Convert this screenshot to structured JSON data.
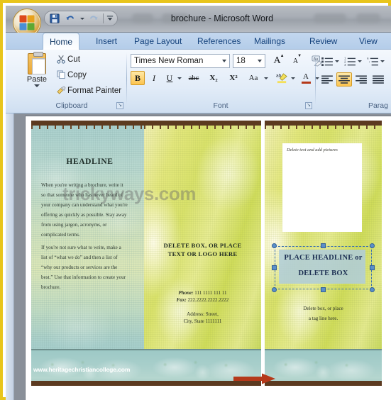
{
  "window": {
    "title": "brochure - Microsoft Word",
    "office_button": "office-orb"
  },
  "quick_access": {
    "items": [
      {
        "name": "save",
        "icon": "save-icon",
        "label": "Save"
      },
      {
        "name": "undo",
        "icon": "undo-icon",
        "label": "Undo"
      },
      {
        "name": "redo",
        "icon": "redo-icon",
        "label": "Redo"
      },
      {
        "name": "customize",
        "icon": "customize-qat-icon",
        "label": "Customize Quick Access Toolbar"
      }
    ]
  },
  "ribbon": {
    "tabs": [
      {
        "label": "Home",
        "active": true
      },
      {
        "label": "Insert",
        "active": false
      },
      {
        "label": "Page Layout",
        "active": false
      },
      {
        "label": "References",
        "active": false
      },
      {
        "label": "Mailings",
        "active": false
      },
      {
        "label": "Review",
        "active": false
      },
      {
        "label": "View",
        "active": false
      }
    ],
    "clipboard": {
      "group_label": "Clipboard",
      "paste_label": "Paste",
      "cut_label": "Cut",
      "copy_label": "Copy",
      "format_painter_label": "Format Painter",
      "cut_icon": "scissors-icon",
      "copy_icon": "copy-icon",
      "format_painter_icon": "paintbrush-icon",
      "paste_icon": "clipboard-icon",
      "launcher_label": "↘"
    },
    "font": {
      "group_label": "Font",
      "font_name": "Times New Roman",
      "font_size": "18",
      "grow_font": "A",
      "shrink_font": "A",
      "clear_formatting": "Aa",
      "bold": "B",
      "italic": "I",
      "underline": "U",
      "strikethrough": "abc",
      "subscript": "X₂",
      "superscript": "X²",
      "change_case": "Aa",
      "highlight": "ab",
      "font_color": "A",
      "bold_active": true,
      "launcher_label": "↘"
    },
    "paragraph": {
      "group_label": "Parag",
      "bullets": "bullets-icon",
      "numbering": "numbering-icon",
      "multilevel": "multilevel-list-icon",
      "align_left": "align-left-icon",
      "align_center": "align-center-icon",
      "align_right": "align-right-icon",
      "justify": "justify-icon",
      "active_alignment": "center"
    }
  },
  "document": {
    "watermark": "trickyways.com",
    "panels": {
      "left": {
        "headline": "HEADLINE",
        "paragraphs": [
          "When you're writing a brochure, write it so that someone who has never heard of your company can understand what you're offering as quickly as possible. Stay away from using jargon, acronyms, or complicated terms.",
          "If you're not sure what to write, make a list of “what we do” and then a list of “why our products or services are the best.” Use that information to create your brochure."
        ],
        "website": "www.heritagechristiancollege.com"
      },
      "middle": {
        "title_line1": "DELETE BOX, OR PLACE",
        "title_line2": "TEXT OR LOGO HERE",
        "phone_label": "Phone:",
        "phone_value": "111 1111 111 11",
        "fax_label": "Fax:",
        "fax_value": "222.2222.2222.2222",
        "address_line1": "Address: Street,",
        "address_line2": "City, State 1111111"
      },
      "right": {
        "picture_placeholder": "Delete text and add pictures",
        "selected_textbox": {
          "line1": "PLACE HEADLINE or",
          "line2": "DELETE BOX",
          "selected": true,
          "handle_color": "#5b8fc9"
        },
        "tagline_line1": "Delete box, or place",
        "tagline_line2": "a tag line here."
      }
    },
    "annotation": {
      "type": "arrow",
      "direction": "right",
      "color": "#b5391a"
    }
  },
  "colors": {
    "frame": "#e8c51c",
    "ribbon_blue": "#c3d7ef",
    "tab_text": "#14427c",
    "active_highlight": "#fcc44f",
    "selection_blue": "#5b8fc9",
    "arrow_red": "#b5391a"
  }
}
